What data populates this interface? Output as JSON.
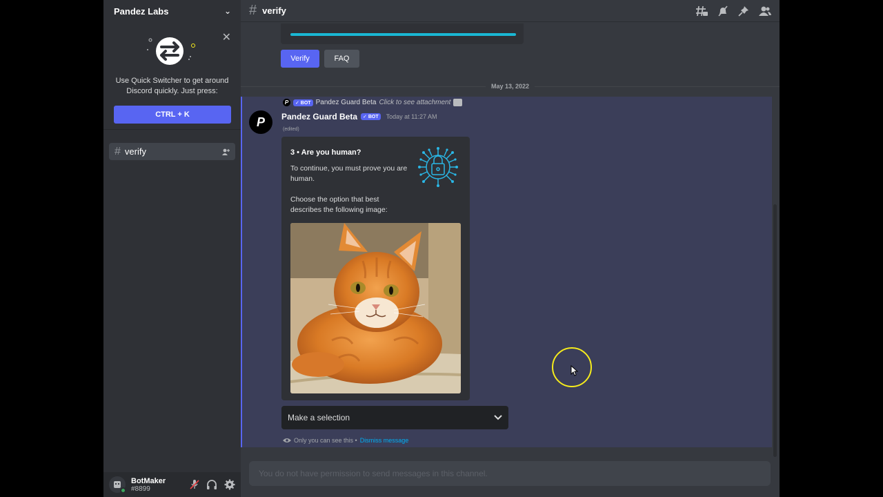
{
  "server": {
    "name": "Pandez Labs"
  },
  "quick_switcher": {
    "text": "Use Quick Switcher to get around Discord quickly. Just press:",
    "shortcut": "CTRL + K"
  },
  "channels": [
    {
      "name": "verify",
      "active": true
    }
  ],
  "user": {
    "name": "BotMaker",
    "tag": "#8899",
    "status": "online"
  },
  "header": {
    "channel": "verify",
    "icons": [
      "threads-icon",
      "notification-off-icon",
      "pin-icon",
      "members-icon"
    ]
  },
  "previous_message": {
    "buttons": [
      {
        "label": "Verify"
      },
      {
        "label": "FAQ"
      }
    ]
  },
  "date_divider": "May 13, 2022",
  "message": {
    "reply_author": "Pandez Guard Beta",
    "reply_text": "Click to see attachment",
    "bot_badge": "✓ BOT",
    "author": "Pandez Guard Beta",
    "timestamp": "Today at 11:27 AM",
    "edited": "(edited)",
    "embed": {
      "title": "3 • Are you human?",
      "description1": "To continue, you must prove you are human.",
      "description2": "Choose the option that best describes the following image:"
    },
    "select_placeholder": "Make a selection",
    "ephemeral_note": "Only you can see this •",
    "dismiss_link": "Dismiss message"
  },
  "composer": {
    "placeholder": "You do not have permission to send messages in this channel."
  },
  "colors": {
    "brand": "#5865f2",
    "highlight": "#3b3e59",
    "link": "#00aff4"
  }
}
